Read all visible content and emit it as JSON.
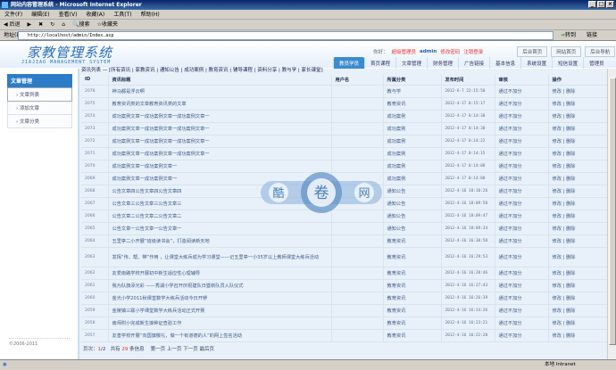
{
  "window": {
    "title": "网站内容管理系统 - Microsoft Internet Explorer"
  },
  "menu": [
    "文件(F)",
    "编辑(E)",
    "查看(V)",
    "收藏(A)",
    "工具(T)",
    "帮助(H)"
  ],
  "toolbar": {
    "back": "后退",
    "search": "搜索",
    "favorites": "收藏夹"
  },
  "address": {
    "label": "地址(D)",
    "url": "http://localhost/admin/Index.asp",
    "go": "转到",
    "links": "链接"
  },
  "header": {
    "logo": "家教管理系统",
    "logo_en": "JIAJIAO MANAGEMENT SYSTEM",
    "greeting": "你好：",
    "role": "超级管理员",
    "user": "admin",
    "change_pwd": "修改密码",
    "logout": "注销登录",
    "buttons": [
      "后台首页",
      "网站首页",
      "后台导航"
    ]
  },
  "nav": [
    {
      "label": "教员学员",
      "active": true
    },
    {
      "label": "首页课程"
    },
    {
      "label": "文章管理"
    },
    {
      "label": "财务管理"
    },
    {
      "label": "广告链接"
    },
    {
      "label": "基本信息"
    },
    {
      "label": "系统设置"
    },
    {
      "label": "短信设置"
    },
    {
      "label": "管理员"
    }
  ],
  "sidebar": {
    "title": "文章管理",
    "items": [
      "文章列表",
      "添加文章",
      "文章分类"
    ],
    "copyright": "©2006-2011"
  },
  "subnav": "资讯列表 — [所有资讯 | 家教资讯 | 通知公告 | 成功案例 | 教育资讯 | 辅导课程 | 资料分享 | 教与学 | 家长课堂]",
  "table": {
    "headers": [
      "ID",
      "资讯标题",
      "用户名",
      "所属分类",
      "发布时间",
      "审核",
      "操作"
    ],
    "edit": "修改",
    "del": "删除",
    "rows": [
      {
        "id": "2076",
        "title": "神马都是浮云啊",
        "user": "",
        "cat": "教与学",
        "time": "2012-6-7 22:15:58",
        "audit": "通过不加分"
      },
      {
        "id": "2075",
        "title": "教育资讯类的文章教育资讯类的文章",
        "user": "",
        "cat": "教育资讯",
        "time": "2012-4-17 0:15:17",
        "audit": "通过不加分"
      },
      {
        "id": "2074",
        "title": "成功案例文章一成功案例文章一成功案例文章一",
        "user": "",
        "cat": "成功案例",
        "time": "2012-4-17 0:14:38",
        "audit": "通过不加分"
      },
      {
        "id": "2073",
        "title": "成功案例文章一成功案例文章一成功案例文章一",
        "user": "",
        "cat": "成功案例",
        "time": "2012-4-17 0:14:30",
        "audit": "通过不加分"
      },
      {
        "id": "2072",
        "title": "成功案例文章一成功案例文章一成功案例文章一",
        "user": "",
        "cat": "成功案例",
        "time": "2012-4-17 0:14:22",
        "audit": "通过不加分"
      },
      {
        "id": "2071",
        "title": "成功案例文章一成功案例文章一成功案例文章一",
        "user": "",
        "cat": "成功案例",
        "time": "2012-4-17 0:14:15",
        "audit": "通过不加分"
      },
      {
        "id": "2070",
        "title": "成功案例文章一成功案例文章一",
        "user": "",
        "cat": "成功案例",
        "time": "2012-4-17 0:14:08",
        "audit": "通过不加分"
      },
      {
        "id": "2069",
        "title": "成功案例文章一成功案例文章一",
        "user": "",
        "cat": "成功案例",
        "time": "2012-4-17 0:14:00",
        "audit": "通过不加分"
      },
      {
        "id": "2068",
        "title": "公告文章四公告文章四公告文章四",
        "user": "",
        "cat": "通知公告",
        "time": "2012-4-16 18:10:26",
        "audit": "通过不加分"
      },
      {
        "id": "2067",
        "title": "公告文章三公告文章三公告文章三",
        "user": "",
        "cat": "通知公告",
        "time": "2012-4-16 18:09:58",
        "audit": "通过不加分"
      },
      {
        "id": "2066",
        "title": "公告文章二公告文章二公告文章二",
        "user": "",
        "cat": "通知公告",
        "time": "2012-4-16 18:09:47",
        "audit": "通过不加分"
      },
      {
        "id": "2065",
        "title": "公告文章一公告文章一公告文章一",
        "user": "",
        "cat": "通知公告",
        "time": "2012-4-16 18:09:34",
        "audit": "通过不加分"
      },
      {
        "id": "2064",
        "title": "五里亭二小开展“班级读书会”，打造阅读新天地",
        "user": "",
        "cat": "教育资讯",
        "time": "2012-4-16 16:30:58",
        "audit": "通过不加分"
      },
      {
        "id": "2063",
        "title": "发挥“传、帮、带”作用 ，让课堂大练兵成为学习课堂——记五里亭一小35岁以上教师课堂大练兵活动",
        "user": "",
        "cat": "教育资讯",
        "time": "2012-4-16 16:29:53",
        "audit": "通过不加分"
      },
      {
        "id": "2062",
        "title": "友爱南路学校开展初中新生适应性心理辅导",
        "user": "",
        "cat": "教育资讯",
        "time": "2012-4-16 16:28:46",
        "audit": "通过不加分"
      },
      {
        "id": "2061",
        "title": "我为队旗添光彩 ——秀湖小学召开庆祝建队日暨新队员入队仪式",
        "user": "",
        "cat": "教育资讯",
        "time": "2012-4-16 16:27:43",
        "audit": "通过不加分"
      },
      {
        "id": "2060",
        "title": "金光小学2011秋课堂数学大练兵活动今日开锣",
        "user": "",
        "cat": "教育资讯",
        "time": "2012-4-16 16:26:39",
        "audit": "通过不加分"
      },
      {
        "id": "2059",
        "title": "金陵镇三联小学课堂数学大练兵活动正式开赛",
        "user": "",
        "cat": "教育资讯",
        "time": "2012-4-16 16:24:26",
        "audit": "通过不加分"
      },
      {
        "id": "2058",
        "title": "南师附小完成新生接种证查验工作",
        "user": "",
        "cat": "教育资讯",
        "time": "2012-4-16 16:23:21",
        "audit": "通过不加分"
      },
      {
        "id": "2057",
        "title": "友善学校开展“向国旗敬礼，做一个有道德的人”的网上签名活动",
        "user": "",
        "cat": "教育资讯",
        "time": "2012-4-16 16:22:20",
        "audit": "通过不加分"
      }
    ]
  },
  "pager": {
    "label": "页次：",
    "current": "1",
    "total_pages": "/2",
    "total_prefix": "共有",
    "count": "29",
    "count_suffix": "条信息",
    "first": "第一页",
    "prev": "上一页",
    "next": "下一页",
    "last": "最后页"
  },
  "watermark": [
    "酷",
    "卷",
    "网"
  ],
  "status": {
    "zone": "本地 Intranet"
  }
}
